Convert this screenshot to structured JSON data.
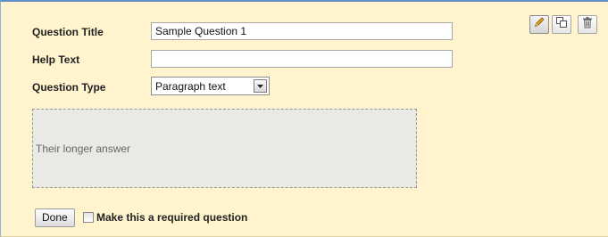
{
  "form": {
    "title_label": "Question Title",
    "title_value": "Sample Question 1",
    "help_label": "Help Text",
    "help_value": "",
    "type_label": "Question Type",
    "type_selected": "Paragraph text"
  },
  "preview": {
    "placeholder": "Their longer answer"
  },
  "toolbar": {
    "edit_icon": "pencil-icon",
    "duplicate_icon": "duplicate-icon",
    "delete_icon": "trash-icon"
  },
  "footer": {
    "done_label": "Done",
    "required_label": "Make this a required question",
    "required_checked": false
  },
  "colors": {
    "panel_background": "#fff4cd",
    "panel_border": "#5f8ec9",
    "preview_background": "#ebe9e4",
    "edit_icon": "#e2a11c"
  }
}
